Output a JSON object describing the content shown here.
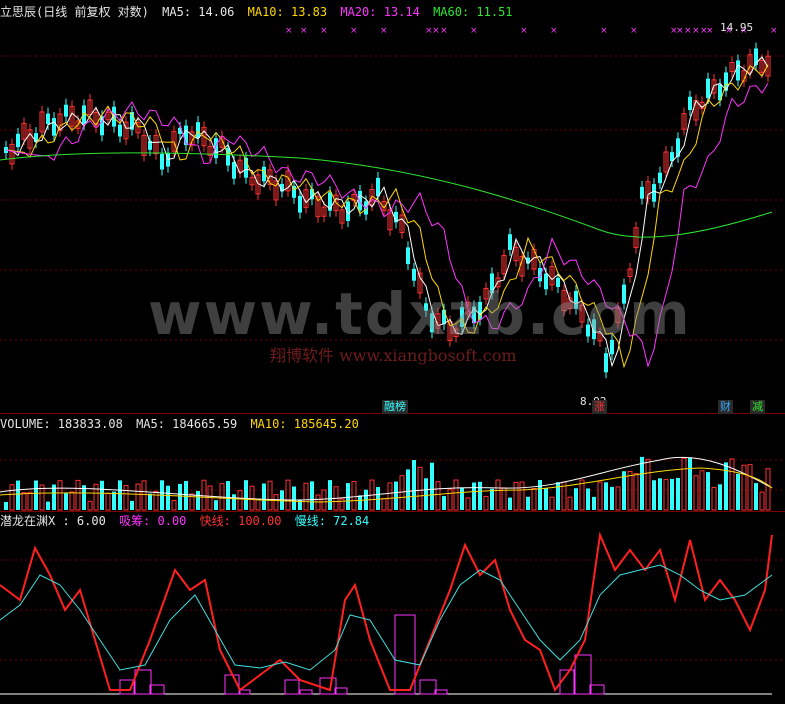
{
  "main": {
    "title": "立思辰(日线 前复权 对数)",
    "ma5": "MA5: 14.06",
    "ma10": "MA10: 13.83",
    "ma20": "MA20: 13.14",
    "ma60": "MA60: 11.51",
    "high_label": "14.95",
    "low_label": "8.92",
    "tags": {
      "t1": "融榜",
      "t2": "涨",
      "t3": "财",
      "t4": "减"
    }
  },
  "volume": {
    "label": "VOLUME: 183833.08",
    "ma5": "MA5: 184665.59",
    "ma10": "MA10: 185645.20"
  },
  "indicator": {
    "name": "潜龙在渊X : 6.00",
    "a": "吸筹: 0.00",
    "b": "快线: 100.00",
    "c": "慢线: 72.84"
  },
  "watermark": {
    "main": "www.tdxzb.com",
    "sub": "翔博软件 www.xiangbosoft.com"
  },
  "colors": {
    "up": "#ff3333",
    "down": "#33ffff",
    "ma5": "#ffffff",
    "ma10": "#ffd800",
    "ma20": "#ff33ff",
    "ma60": "#2ee62e"
  }
}
